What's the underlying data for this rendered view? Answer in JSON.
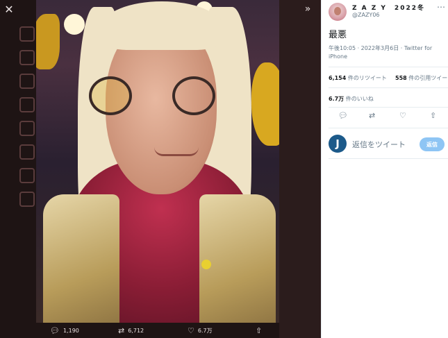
{
  "viewer": {
    "close_icon": "✕",
    "collapse_icon": "»",
    "actions": {
      "reply_count": "1,190",
      "retweet_count": "6,712",
      "like_count": "6.7万"
    }
  },
  "tweet": {
    "display_name": "Z A Z Y　2022冬",
    "handle": "@ZAZY06",
    "text": "最悪",
    "timestamp": "午後10:05 · 2022年3月6日 · Twitter for iPhone",
    "retweets": "6,154",
    "retweets_label": "件のリツイート",
    "quotes": "558",
    "quotes_label": "件の引用ツイート",
    "likes": "6.7万",
    "likes_label": "件のいいね",
    "reply_placeholder": "返信をツイート",
    "reply_button": "返信",
    "reply_avatar_letter": "J"
  },
  "colors": {
    "accent": "#1da1f2",
    "reply_button_bg": "#8ec5f4"
  }
}
